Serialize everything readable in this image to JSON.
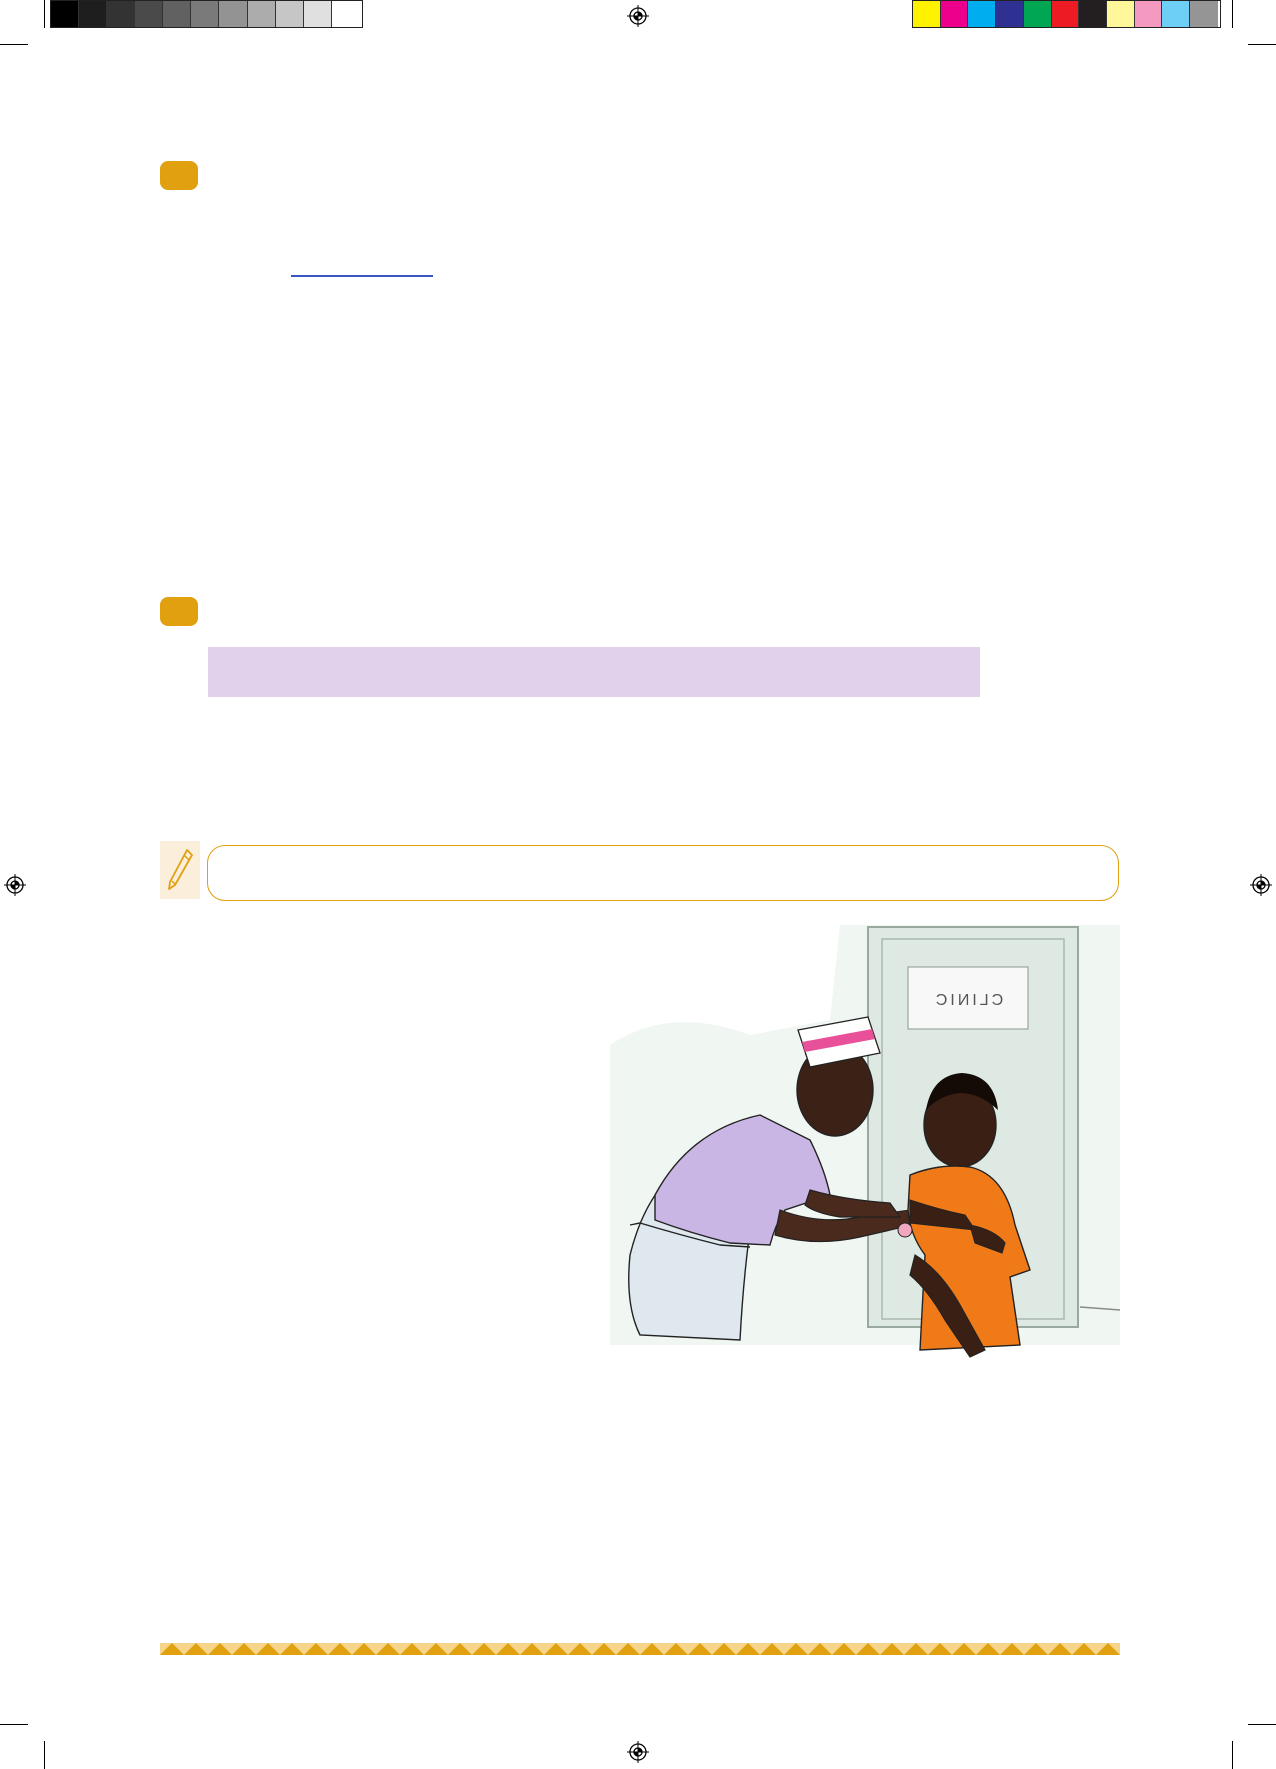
{
  "color_bars": {
    "grayscale": [
      "#000000",
      "#1e1e1e",
      "#333333",
      "#4a4a4a",
      "#616161",
      "#7a7a7a",
      "#939393",
      "#acacac",
      "#c6c6c6",
      "#e0e0e0",
      "#ffffff"
    ],
    "process": [
      "#fff200",
      "#ec008c",
      "#00aeef",
      "#2e3192",
      "#00a651",
      "#ed1c24",
      "#231f20",
      "#fff799",
      "#f49ac1",
      "#6dcff6",
      "#959595"
    ]
  },
  "colors": {
    "bullet": "#e0a010",
    "highlight": "#e2d1ea",
    "link": "#3a55c8",
    "note_border": "#e0a010"
  },
  "illustration": {
    "sign_text": "CLINIC"
  },
  "icons": {
    "pen": "pen-icon",
    "registration": "registration-mark-icon"
  }
}
